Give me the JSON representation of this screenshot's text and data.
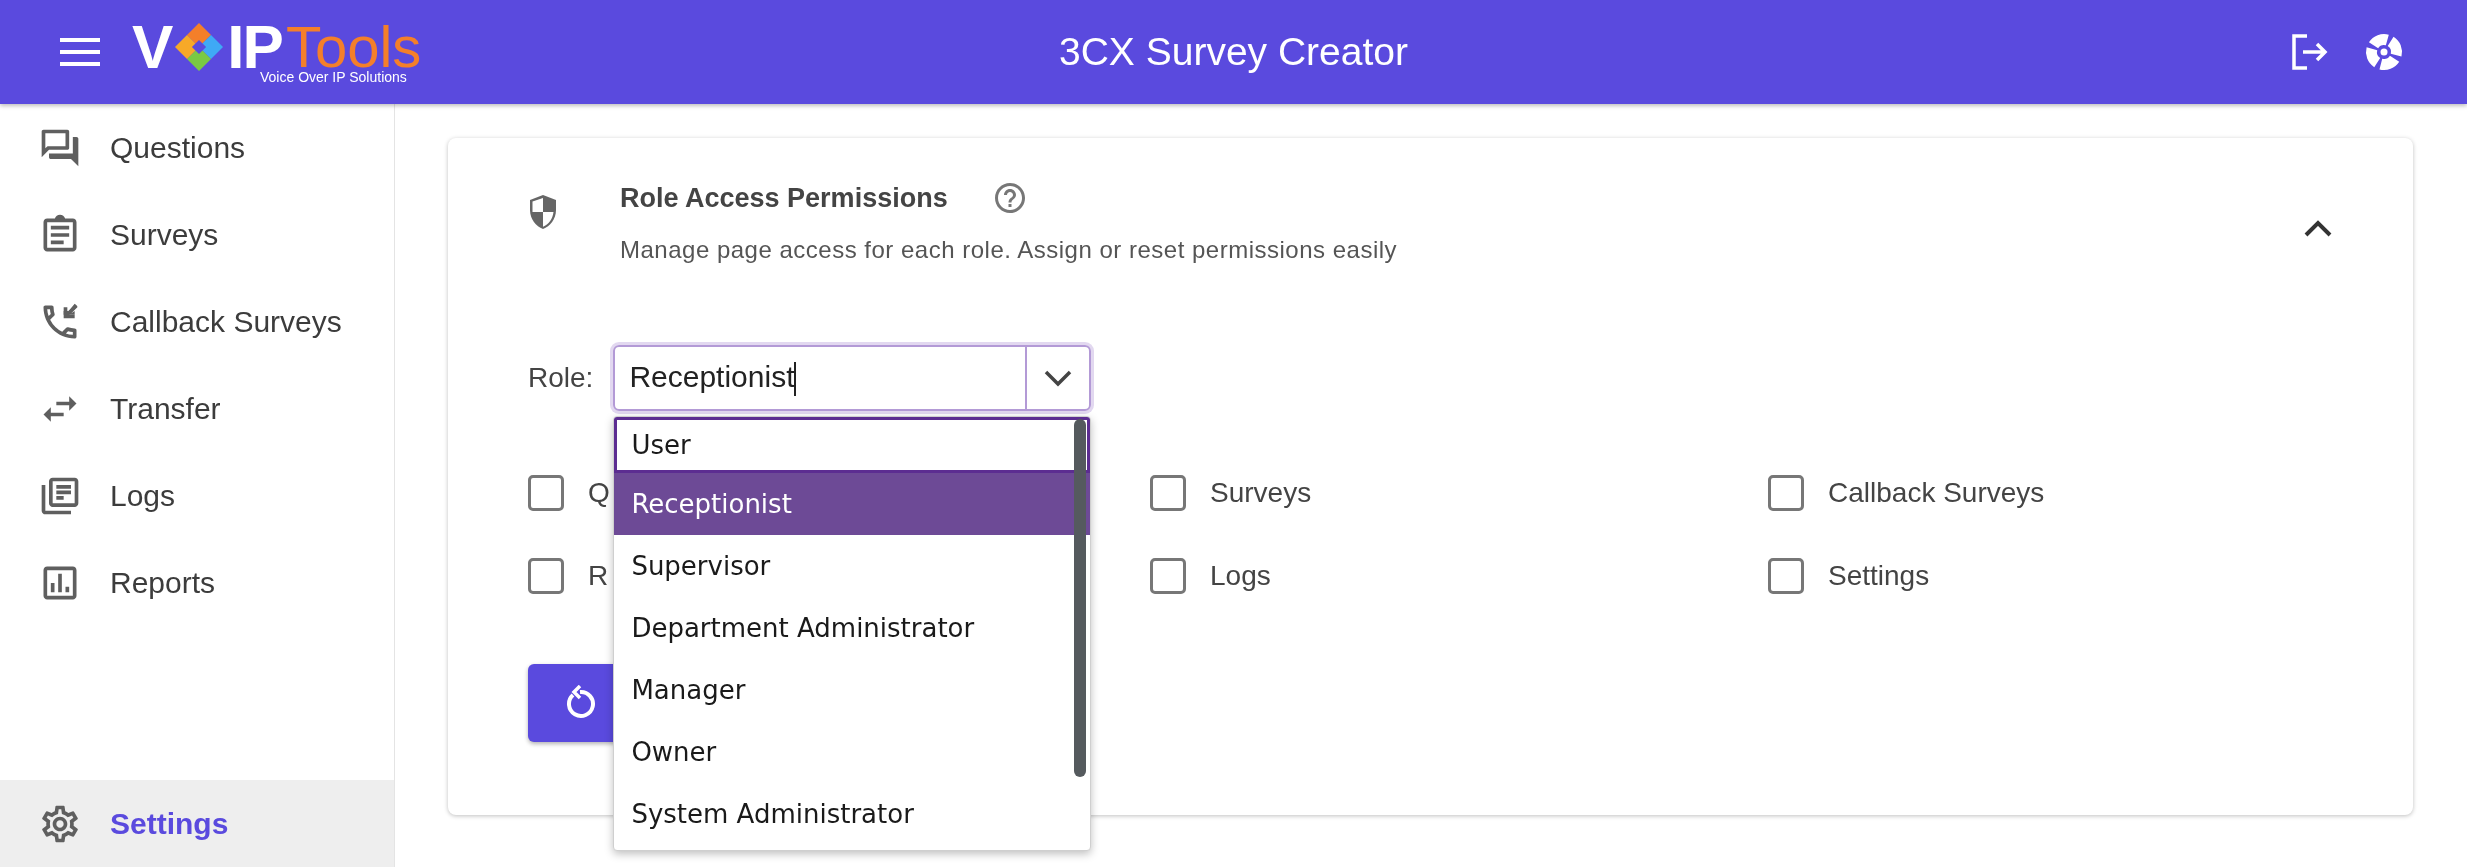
{
  "header": {
    "logo": {
      "lead": "V",
      "mid": "IP",
      "accent": "Tools",
      "tagline": "Voice Over IP Solutions"
    },
    "title": "3CX Survey Creator"
  },
  "sidebar": {
    "items": [
      {
        "label": "Questions",
        "selected": false
      },
      {
        "label": "Surveys",
        "selected": false
      },
      {
        "label": "Callback Surveys",
        "selected": false
      },
      {
        "label": "Transfer",
        "selected": false
      },
      {
        "label": "Logs",
        "selected": false
      },
      {
        "label": "Reports",
        "selected": false
      }
    ],
    "footer_item": {
      "label": "Settings",
      "selected": true
    }
  },
  "panel": {
    "title": "Role Access Permissions",
    "subtitle": "Manage page access for each role. Assign or reset permissions easily",
    "expanded": true,
    "role": {
      "label": "Role:",
      "value": "Receptionist",
      "open": true,
      "options": [
        {
          "label": "User",
          "selected": false,
          "focused": true
        },
        {
          "label": "Receptionist",
          "selected": true,
          "focused": false
        },
        {
          "label": "Supervisor",
          "selected": false,
          "focused": false
        },
        {
          "label": "Department Administrator",
          "selected": false,
          "focused": false
        },
        {
          "label": "Manager",
          "selected": false,
          "focused": false
        },
        {
          "label": "Owner",
          "selected": false,
          "focused": false
        },
        {
          "label": "System Administrator",
          "selected": false,
          "focused": false
        }
      ]
    },
    "permissions": [
      {
        "label": "Q",
        "checked": false
      },
      {
        "label": "Surveys",
        "checked": false
      },
      {
        "label": "Callback Surveys",
        "checked": false
      },
      {
        "label": "R",
        "checked": false
      },
      {
        "label": "Logs",
        "checked": false
      },
      {
        "label": "Settings",
        "checked": false
      }
    ]
  }
}
